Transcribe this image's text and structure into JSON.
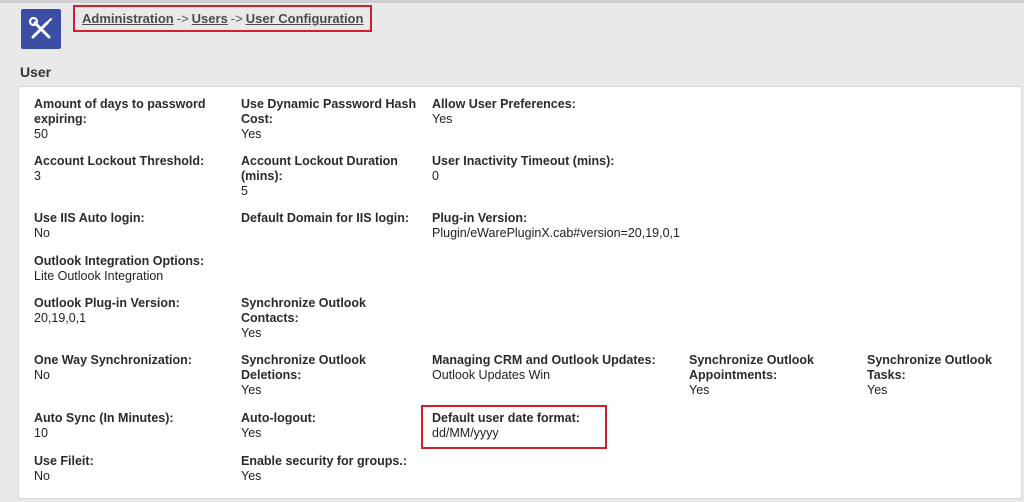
{
  "breadcrumb": {
    "items": [
      "Administration",
      "Users",
      "User Configuration"
    ],
    "separator": "->"
  },
  "section": {
    "title": "User"
  },
  "fields": {
    "password_expiry": {
      "label": "Amount of days to password expiring:",
      "value": "50"
    },
    "dyn_hash_cost": {
      "label": "Use Dynamic Password Hash Cost:",
      "value": "Yes"
    },
    "allow_prefs": {
      "label": "Allow User Preferences:",
      "value": "Yes"
    },
    "lockout_threshold": {
      "label": "Account Lockout Threshold:",
      "value": "3"
    },
    "lockout_duration": {
      "label": "Account Lockout Duration (mins):",
      "value": "5"
    },
    "inactivity_timeout": {
      "label": "User Inactivity Timeout (mins):",
      "value": "0"
    },
    "iis_auto_login": {
      "label": "Use IIS Auto login:",
      "value": "No"
    },
    "iis_domain": {
      "label": "Default Domain for IIS login:",
      "value": ""
    },
    "plugin_version": {
      "label": "Plug-in Version:",
      "value": "Plugin/eWarePluginX.cab#version=20,19,0,1"
    },
    "outlook_options": {
      "label": "Outlook Integration Options:",
      "value": "Lite Outlook Integration"
    },
    "outlook_plugin_version": {
      "label": "Outlook Plug-in Version:",
      "value": "20,19,0,1"
    },
    "sync_contacts": {
      "label": "Synchronize Outlook Contacts:",
      "value": "Yes"
    },
    "one_way_sync": {
      "label": "One Way Synchronization:",
      "value": "No"
    },
    "sync_deletions": {
      "label": "Synchronize Outlook Deletions:",
      "value": "Yes"
    },
    "crm_outlook_updates": {
      "label": "Managing CRM and Outlook Updates:",
      "value": "Outlook Updates Win"
    },
    "sync_appointments": {
      "label": "Synchronize Outlook Appointments:",
      "value": "Yes"
    },
    "sync_tasks": {
      "label": "Synchronize Outlook Tasks:",
      "value": "Yes"
    },
    "auto_sync": {
      "label": "Auto Sync (In Minutes):",
      "value": "10"
    },
    "auto_logout": {
      "label": "Auto-logout:",
      "value": "Yes"
    },
    "date_format": {
      "label": "Default user date format:",
      "value": "dd/MM/yyyy"
    },
    "use_fileit": {
      "label": "Use Fileit:",
      "value": "No"
    },
    "group_security": {
      "label": "Enable security for groups.:",
      "value": "Yes"
    }
  },
  "colors": {
    "icon_bg": "#3c4ea3",
    "highlight": "#d21f2a",
    "background": "#e9e9ea"
  },
  "icons": {
    "app": "tools-icon"
  }
}
